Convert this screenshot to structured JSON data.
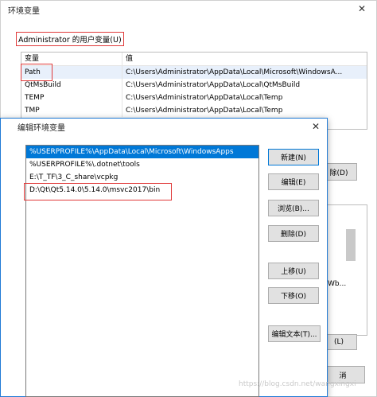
{
  "background_window": {
    "title": "环境变量",
    "user_group_label": "Administrator 的用户变量(U)",
    "columns": [
      "变量",
      "值"
    ],
    "rows": [
      {
        "name": "Path",
        "value": "C:\\Users\\Administrator\\AppData\\Local\\Microsoft\\WindowsA..."
      },
      {
        "name": "QtMsBuild",
        "value": "C:\\Users\\Administrator\\AppData\\Local\\QtMsBuild"
      },
      {
        "name": "TEMP",
        "value": "C:\\Users\\Administrator\\AppData\\Local\\Temp"
      },
      {
        "name": "TMP",
        "value": "C:\\Users\\Administrator\\AppData\\Local\\Temp"
      }
    ],
    "delete_user_button": "除(D)",
    "system_partial_text": "Wb...",
    "delete_system_button": "(L)",
    "cancel_button": "消"
  },
  "edit_dialog": {
    "title": "编辑环境变量",
    "items": [
      "%USERPROFILE%\\AppData\\Local\\Microsoft\\WindowsApps",
      "%USERPROFILE%\\.dotnet\\tools",
      "E:\\T_TF\\3_C_share\\vcpkg",
      "D:\\Qt\\Qt5.14.0\\5.14.0\\msvc2017\\bin"
    ],
    "buttons": {
      "new": "新建(N)",
      "edit": "编辑(E)",
      "browse": "浏览(B)...",
      "delete": "删除(D)",
      "move_up": "上移(U)",
      "move_down": "下移(O)",
      "edit_text": "编辑文本(T)..."
    }
  },
  "watermark": "https://blog.csdn.net/wangxingxi"
}
